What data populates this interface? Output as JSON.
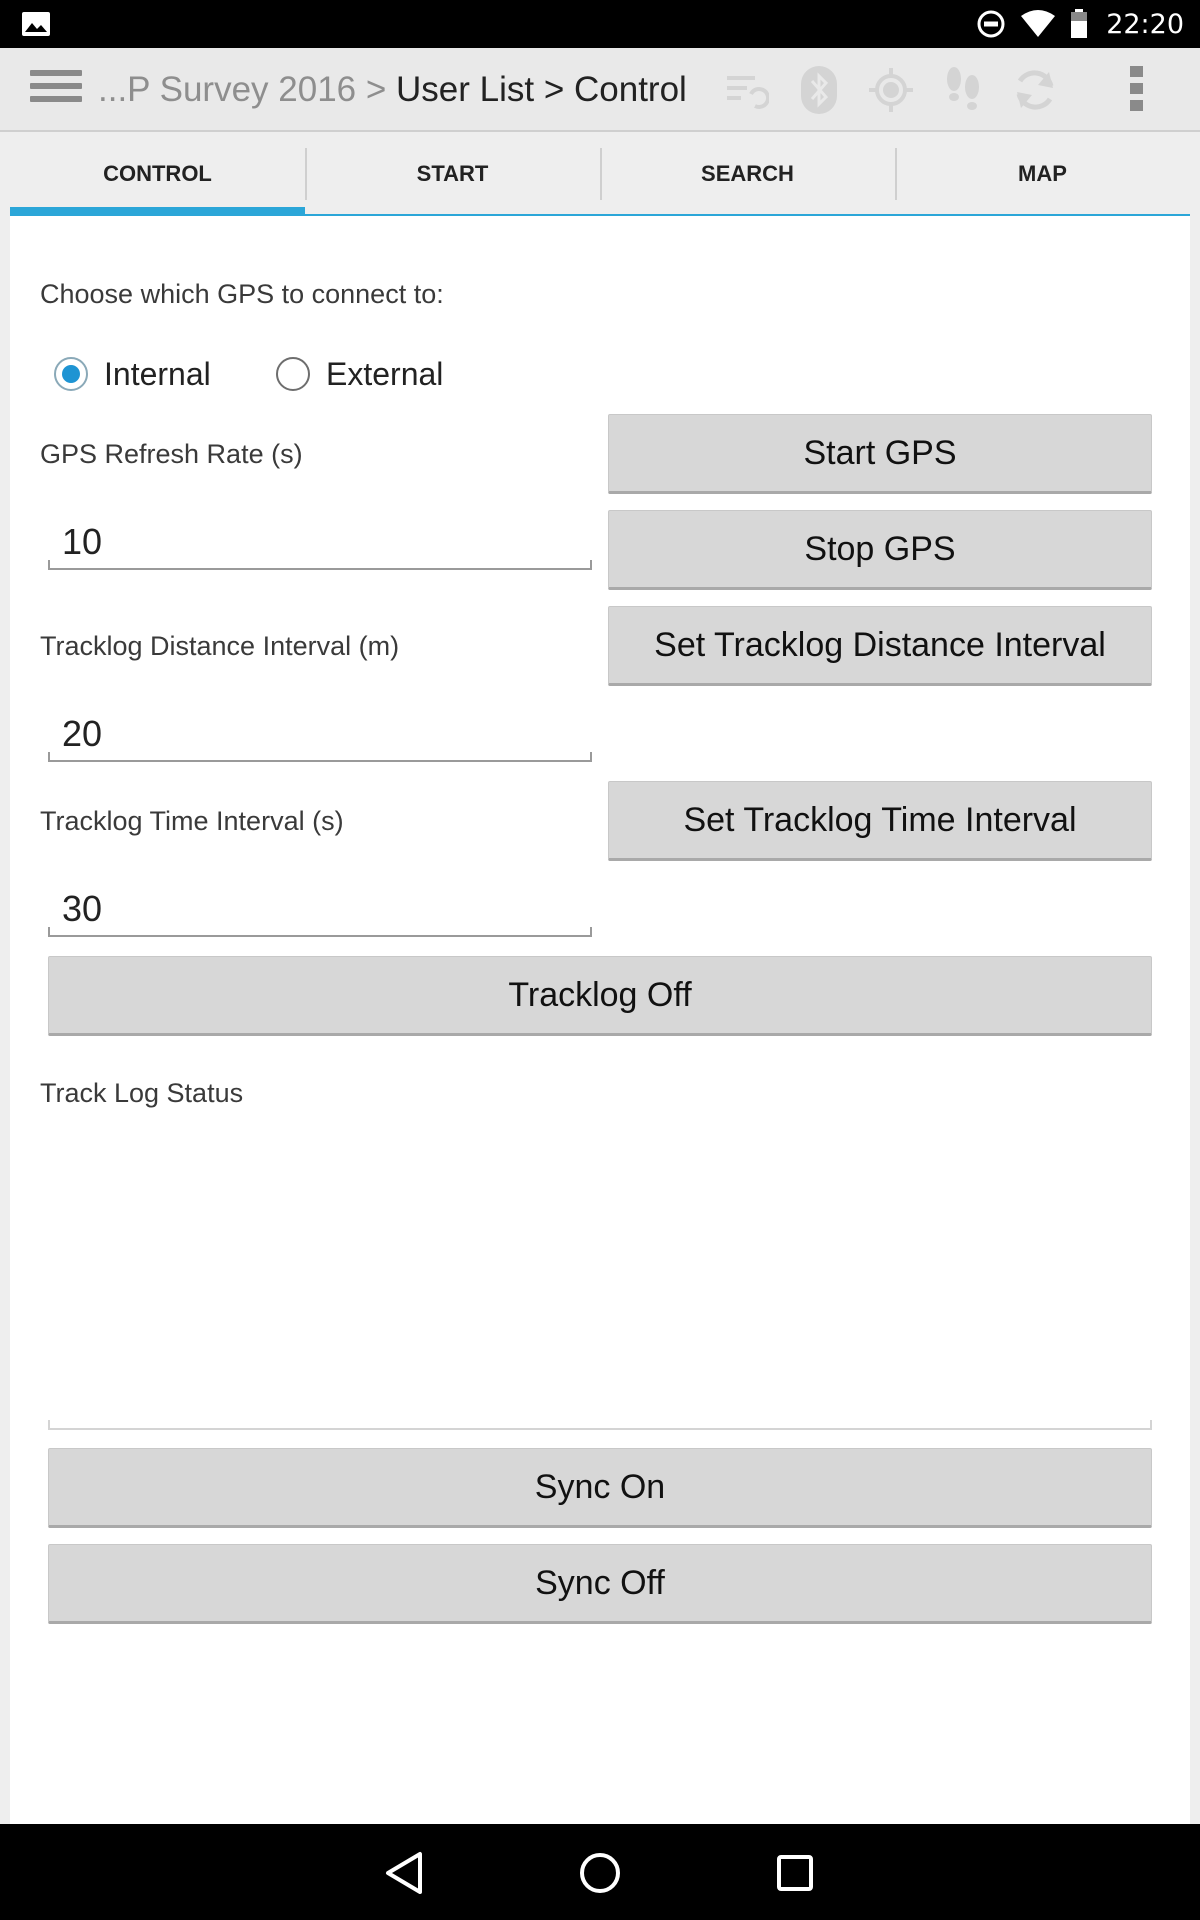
{
  "status_bar": {
    "time": "22:20",
    "icons": [
      "image-notification-icon",
      "do-not-disturb-icon",
      "wifi-icon",
      "battery-icon"
    ]
  },
  "action_bar": {
    "title_prefix": "...P Survey 2016 > ",
    "title_current": "User List > Control",
    "icons": [
      "drawer-menu-icon",
      "sync-list-icon",
      "bluetooth-icon",
      "gps-target-icon",
      "footprints-icon",
      "refresh-icon",
      "overflow-menu-icon"
    ]
  },
  "tabs": [
    {
      "label": "CONTROL",
      "active": true
    },
    {
      "label": "START",
      "active": false
    },
    {
      "label": "SEARCH",
      "active": false
    },
    {
      "label": "MAP",
      "active": false
    }
  ],
  "gps_choice": {
    "prompt": "Choose which GPS to connect to:",
    "options": [
      {
        "label": "Internal",
        "selected": true
      },
      {
        "label": "External",
        "selected": false
      }
    ]
  },
  "refresh_rate": {
    "label": "GPS Refresh Rate (s)",
    "value": "10",
    "start_button": "Start GPS",
    "stop_button": "Stop GPS"
  },
  "distance_interval": {
    "label": "Tracklog Distance Interval (m)",
    "value": "20",
    "button": "Set Tracklog Distance Interval"
  },
  "time_interval": {
    "label": "Tracklog Time Interval (s)",
    "value": "30",
    "button": "Set Tracklog Time Interval"
  },
  "tracklog_toggle": "Tracklog Off",
  "track_log_status": {
    "label": "Track Log Status",
    "value": ""
  },
  "sync": {
    "on_button": "Sync On",
    "off_button": "Sync Off"
  },
  "colors": {
    "accent": "#2ba6d8",
    "radio_selected": "#1e94d3",
    "button_bg": "#d7d7d7"
  }
}
